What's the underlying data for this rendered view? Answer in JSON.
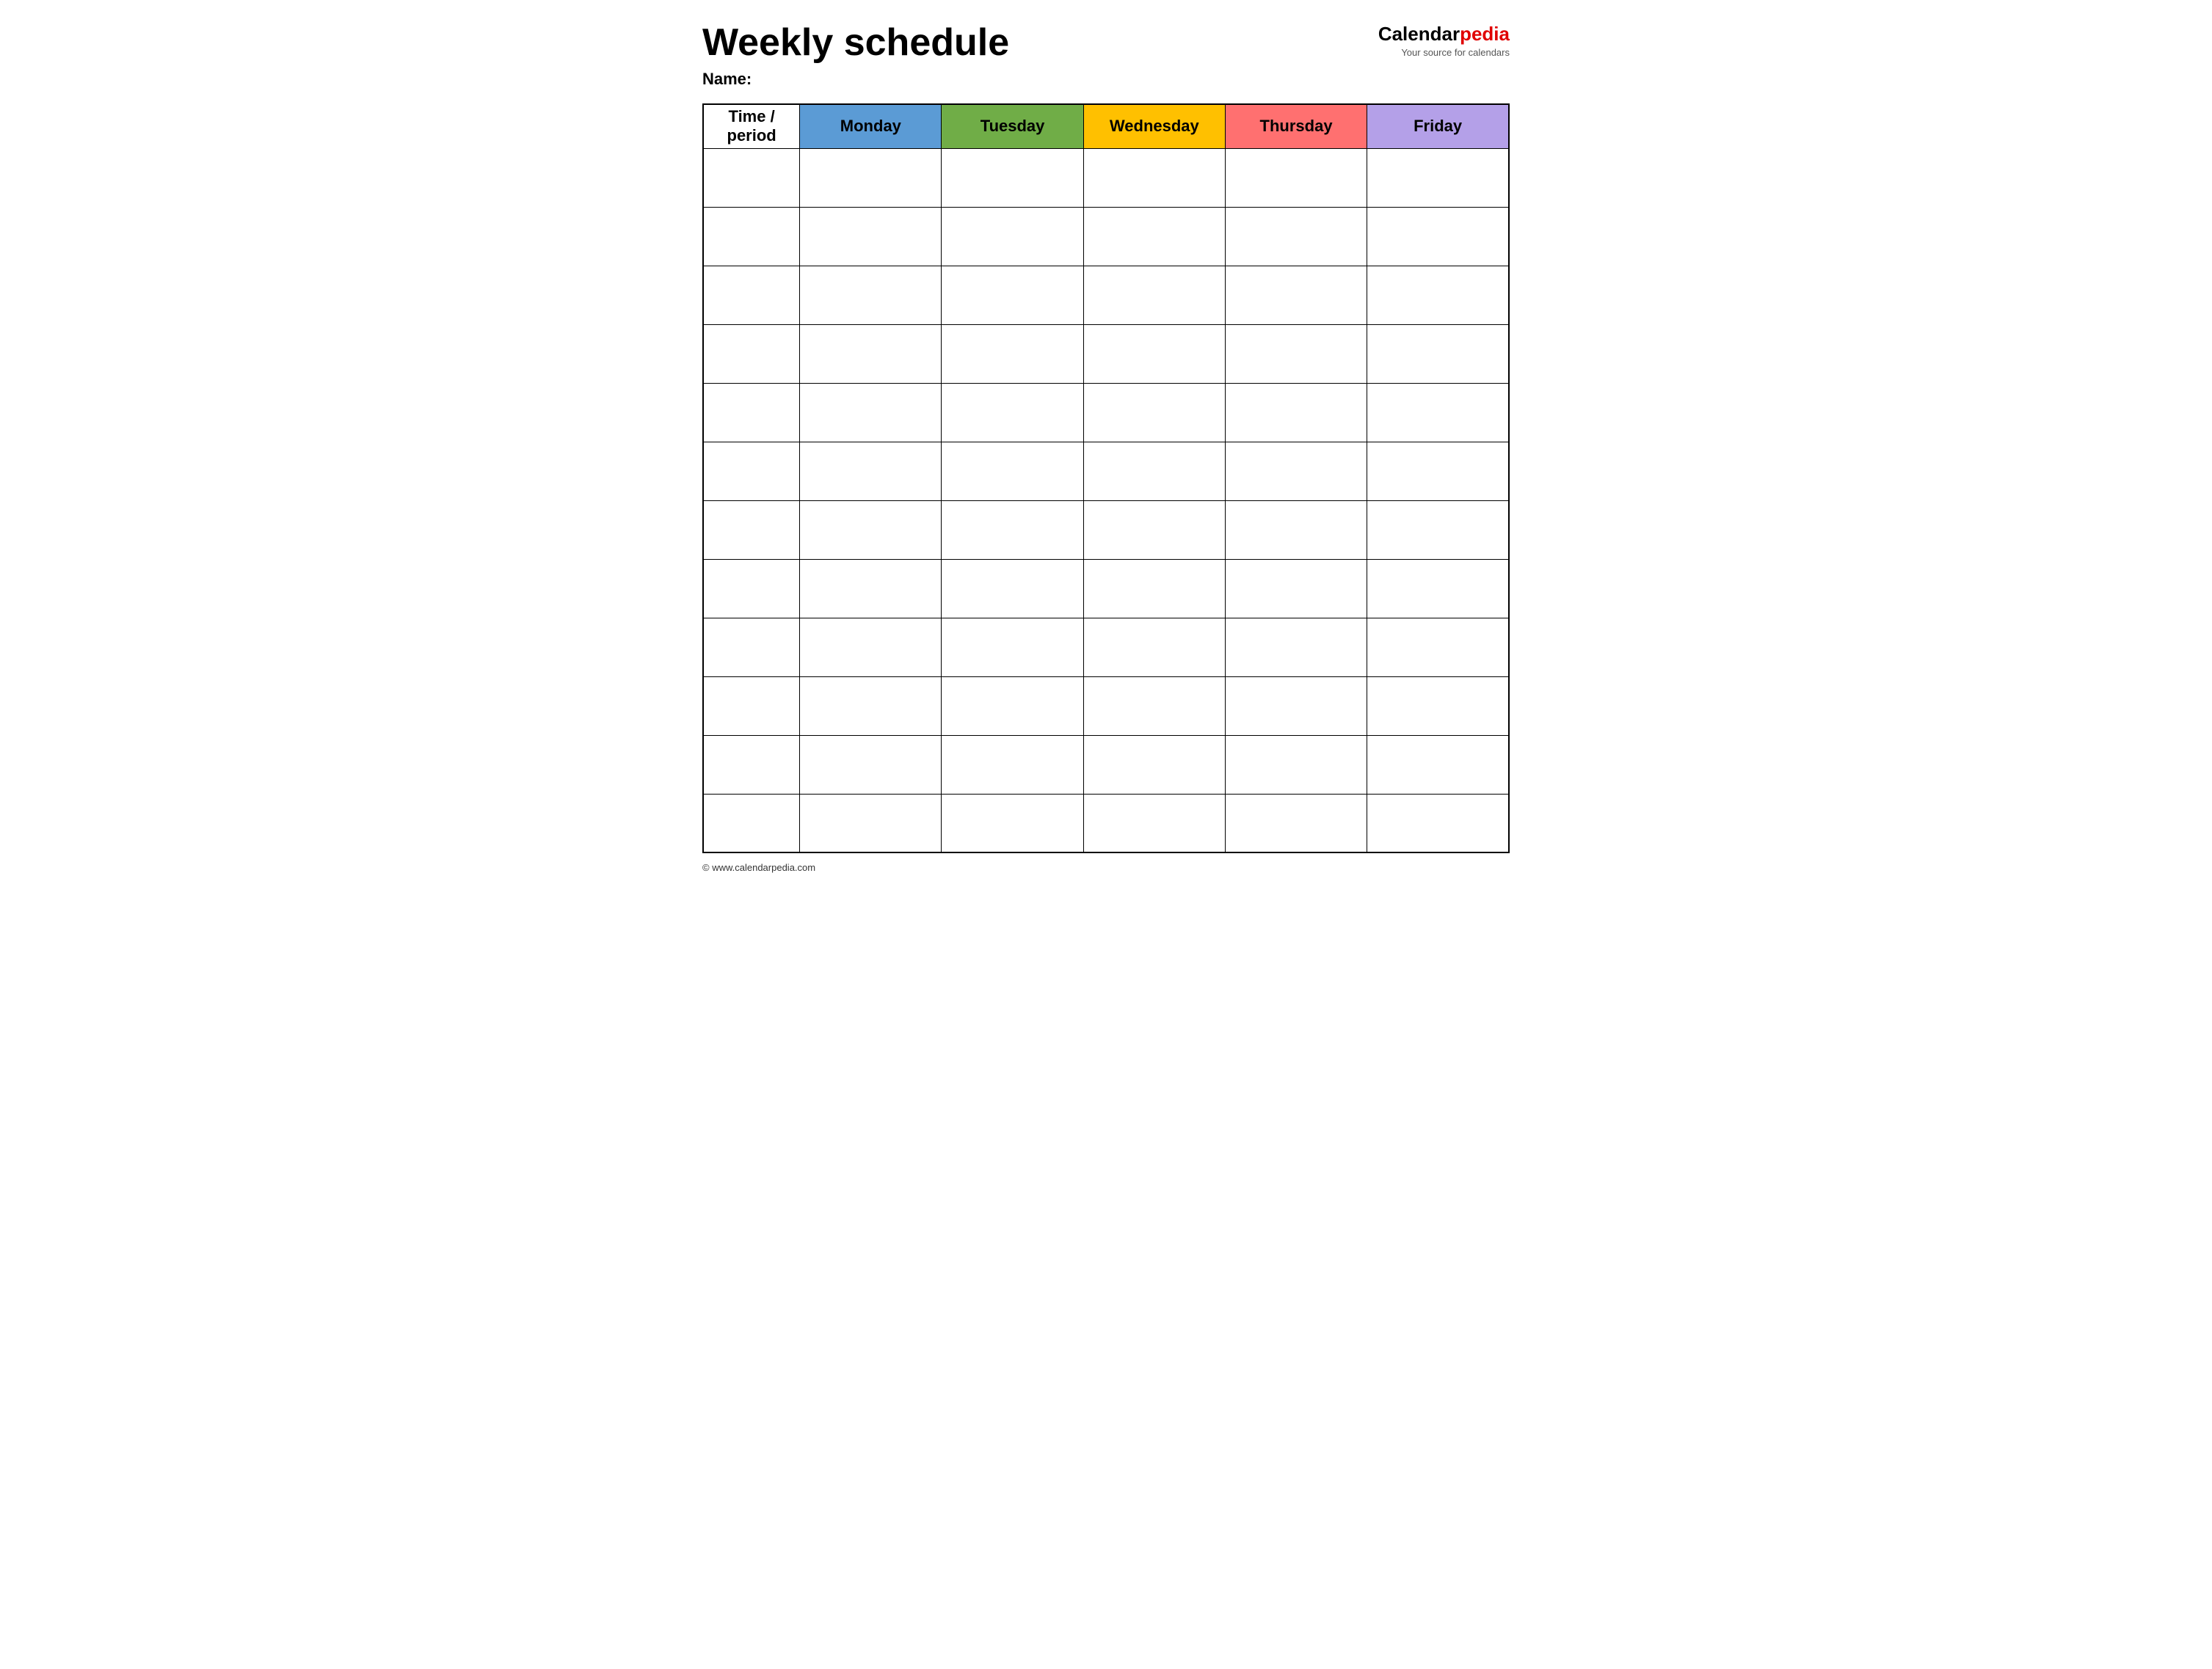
{
  "header": {
    "main_title": "Weekly schedule",
    "name_label": "Name:",
    "logo": {
      "text_calendar": "Calendar",
      "text_pedia": "pedia",
      "subtext": "Your source for calendars"
    }
  },
  "table": {
    "columns": [
      {
        "id": "time",
        "label": "Time / period",
        "color": "#ffffff"
      },
      {
        "id": "monday",
        "label": "Monday",
        "color": "#5b9bd5"
      },
      {
        "id": "tuesday",
        "label": "Tuesday",
        "color": "#70ad47"
      },
      {
        "id": "wednesday",
        "label": "Wednesday",
        "color": "#ffc000"
      },
      {
        "id": "thursday",
        "label": "Thursday",
        "color": "#ff7070"
      },
      {
        "id": "friday",
        "label": "Friday",
        "color": "#b4a0e8"
      }
    ],
    "row_count": 12
  },
  "footer": {
    "copyright": "© www.calendarpedia.com"
  }
}
